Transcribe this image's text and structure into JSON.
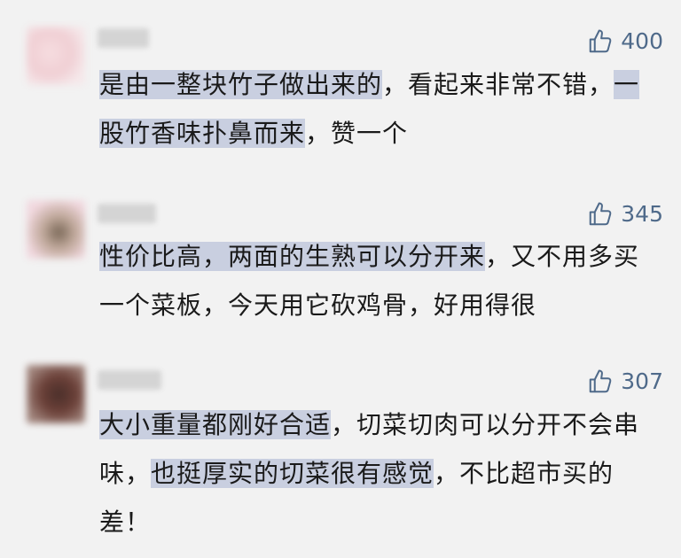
{
  "comments": [
    {
      "likes": "400",
      "text_parts": [
        {
          "t": "是由一整块竹子做出来的",
          "hl": true
        },
        {
          "t": "，看起来非常不错，",
          "hl": false
        },
        {
          "t": "一股竹香味扑鼻而来",
          "hl": true
        },
        {
          "t": "，赞一个",
          "hl": false
        }
      ]
    },
    {
      "likes": "345",
      "text_parts": [
        {
          "t": "性价比高，两面的生熟可以分开来",
          "hl": true
        },
        {
          "t": "，又不用多买一个菜板，今天用它砍鸡骨，好用得很",
          "hl": false
        }
      ]
    },
    {
      "likes": "307",
      "text_parts": [
        {
          "t": "大小重量都刚好合适",
          "hl": true
        },
        {
          "t": "，切菜切肉可以分开不会串味，",
          "hl": false
        },
        {
          "t": "也挺厚实的切菜很有感觉",
          "hl": true
        },
        {
          "t": "，不比超市买的差！",
          "hl": false
        }
      ]
    }
  ],
  "colors": {
    "background": "#f2f2f2",
    "highlight": "#c9cfe0",
    "like": "#4f6a8a",
    "text": "#1a1a1a"
  },
  "icons": {
    "like": "thumbs-up-icon"
  }
}
